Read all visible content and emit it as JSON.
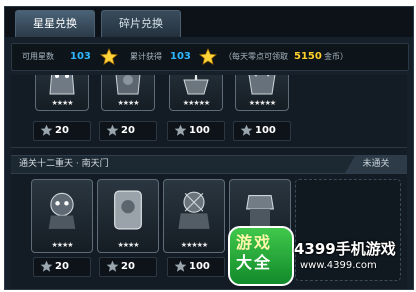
{
  "tabs": [
    {
      "label": "星星兑换",
      "active": true
    },
    {
      "label": "碎片兑换",
      "active": false
    }
  ],
  "stats": {
    "available_label": "可用星数",
    "available_value": "103",
    "total_label": "累计获得",
    "total_value": "103",
    "daily_label": "（每天零点可领取",
    "daily_value": "5150",
    "daily_suffix": "金币）"
  },
  "section_top": {
    "rewards": [
      {
        "stars": "★★★★",
        "cost": "20"
      },
      {
        "stars": "★★★★",
        "cost": "20"
      },
      {
        "stars": "★★★★★",
        "cost": "100"
      },
      {
        "stars": "★★★★★",
        "cost": "100"
      }
    ]
  },
  "section_bottom": {
    "title": "通关十二重天 · 南天门",
    "status": "未通关",
    "rewards": [
      {
        "stars": "★★★★",
        "cost": "20"
      },
      {
        "stars": "★★★★",
        "cost": "20"
      },
      {
        "stars": "★★★★★",
        "cost": "100"
      },
      {
        "stars": "★★★★★",
        "cost": "100"
      }
    ]
  },
  "watermark": {
    "logo_line1": "游戏",
    "logo_line2": "大全",
    "brand": "4399手机游戏",
    "url": "www.4399.com"
  },
  "colors": {
    "accent_blue": "#2fb8ff",
    "gold": "#ffd02a",
    "panel": "#16202a"
  },
  "icons": {
    "star": "star-icon",
    "cost": "star-coin-icon"
  }
}
